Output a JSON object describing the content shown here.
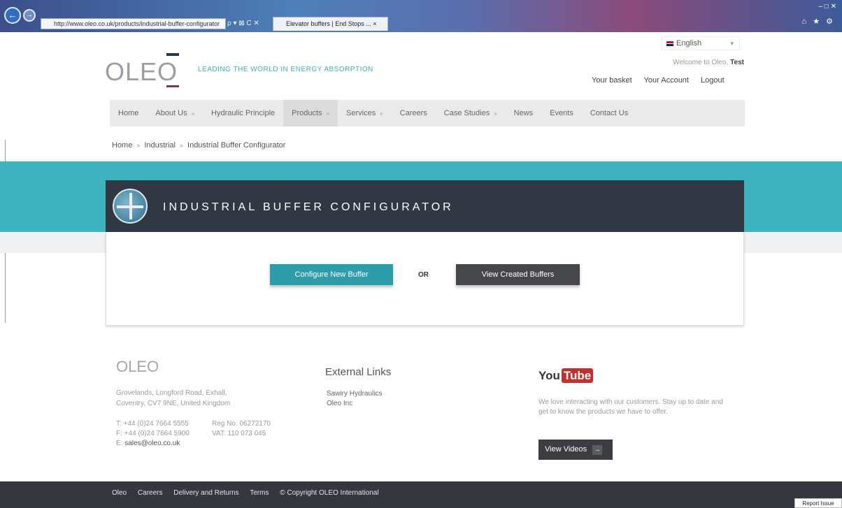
{
  "browser": {
    "address": "http://www.oleo.co.uk/products/industrial-buffer-configurator",
    "address_tools": "ρ ▾ ⊠ C ✕",
    "tab_title": "Elevator buffers | End Stops ... ×",
    "back_glyph": "←",
    "forward_glyph": "→",
    "window_controls": "– □ ✕",
    "page_tools": "⌂ ★ ⚙"
  },
  "header": {
    "logo": "OLEO",
    "tagline": "LEADING THE WORLD IN ENERGY ABSORPTION",
    "language": "English",
    "welcome": "Welcome to Oleo,",
    "user": "Test",
    "links": [
      "Your basket",
      "Your Account",
      "Logout"
    ]
  },
  "nav": {
    "items": [
      {
        "label": "Home"
      },
      {
        "label": "About Us",
        "arrow": "»"
      },
      {
        "label": "Hydraulic Principle"
      },
      {
        "label": "Products",
        "arrow": "»"
      },
      {
        "label": "Services",
        "arrow": "»"
      },
      {
        "label": "Careers"
      },
      {
        "label": "Case Studies",
        "arrow": "»"
      },
      {
        "label": "News"
      },
      {
        "label": "Events"
      },
      {
        "label": "Contact Us"
      }
    ]
  },
  "breadcrumb": {
    "items": [
      "Home",
      "Industrial",
      "Industrial Buffer Configurator"
    ],
    "separator": "»"
  },
  "configurator": {
    "title": "INDUSTRIAL BUFFER CONFIGURATOR",
    "configure_label": "Configure New Buffer",
    "or_label": "OR",
    "view_label": "View Created Buffers"
  },
  "footer": {
    "logo": "OLEO",
    "address_line1": "Grovelands, Longford Road, Exhall,",
    "address_line2": "Coventry, CV7 9NE, United Kingdom",
    "tel": "T: +44 (0)24 7664 5555",
    "fax": "F: +44 (0)24 7664 5900",
    "reg": "Reg No. 06272170",
    "vat": "VAT: 110 073 045",
    "email_prefix": "E:",
    "email": "sales@oleo.co.uk",
    "external_title": "External Links",
    "external_links": [
      "Sawiry Hydraulics",
      "Oleo Inc"
    ],
    "youtube_you": "You",
    "youtube_tube": "Tube",
    "youtube_text": "We love interacting with our customers. Stay up to date and get to know the products we have to offer.",
    "youtube_button": "View Videos",
    "youtube_arrow": "→"
  },
  "bottom_bar": {
    "links": [
      "Oleo",
      "Careers",
      "Delivery and Returns",
      "Terms",
      "© Copyright OLEO International"
    ],
    "report_label": "Report Issue"
  },
  "colors": {
    "teal": "#3db3bd",
    "dark_panel": "#323843",
    "config_button": "#2d9ea9",
    "view_button": "#45474b",
    "footer_bar": "#34373e"
  }
}
